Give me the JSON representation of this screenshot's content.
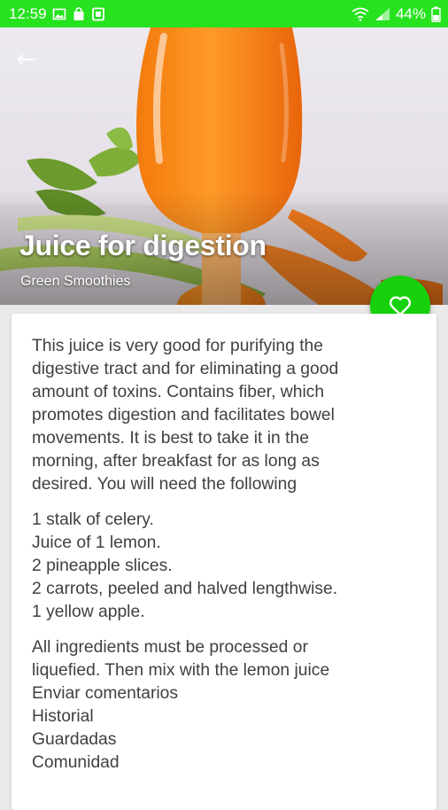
{
  "status_bar": {
    "time": "12:59",
    "battery": "44%",
    "left_icons": [
      "image-icon",
      "shopping-bag-icon",
      "square-app-icon"
    ],
    "right_icons": [
      "wifi-icon",
      "signal-icon",
      "battery-icon"
    ]
  },
  "hero": {
    "title": "Juice for digestion",
    "subtitle": "Green Smoothies",
    "back_icon": "back-arrow-icon"
  },
  "favorite": {
    "icon": "heart-outline-icon",
    "color": "#17d10c"
  },
  "article": {
    "intro_lines": [
      "This juice is very good for purifying the",
      "digestive tract and for eliminating a good",
      "amount of toxins. Contains fiber, which",
      "promotes digestion and facilitates bowel",
      "movements. It is best to take it in the",
      "morning, after breakfast for as long as",
      "desired. You will need the following"
    ],
    "ingredients": [
      "1 stalk of celery.",
      "Juice of 1 lemon.",
      "2 pineapple slices.",
      "2 carrots, peeled and halved lengthwise.",
      "1 yellow apple."
    ],
    "instructions_lines": [
      "All ingredients must be processed or",
      "liquefied. Then mix with the lemon juice"
    ],
    "extra_links": [
      "Enviar comentarios",
      "Historial",
      "Guardadas",
      "Comunidad"
    ]
  },
  "colors": {
    "status_bar": "#27e21f",
    "accent": "#17d10c",
    "body_text": "#404040",
    "background": "#e9e9e9"
  }
}
